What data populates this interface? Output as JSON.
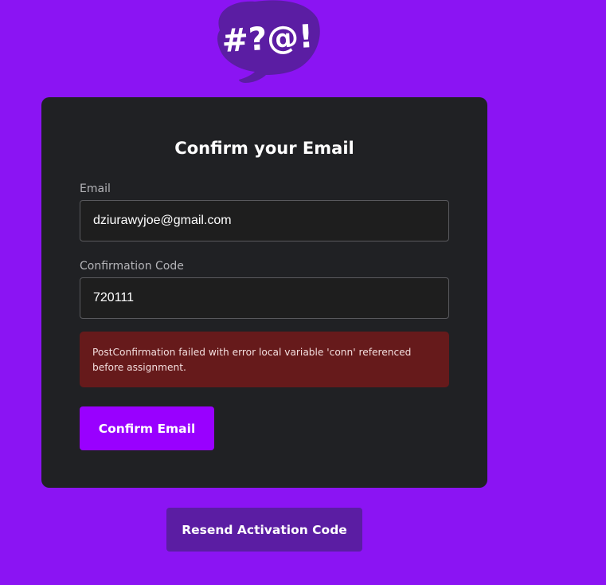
{
  "logo": {
    "text": "#?@!",
    "bubble_color": "#5b1da3"
  },
  "card": {
    "title": "Confirm your Email",
    "email": {
      "label": "Email",
      "value": "dziurawyjoe@gmail.com"
    },
    "code": {
      "label": "Confirmation Code",
      "value": "720111"
    },
    "error_message": "PostConfirmation failed with error local variable 'conn' referenced before assignment.",
    "confirm_button": "Confirm Email"
  },
  "resend_button": "Resend Activation Code",
  "colors": {
    "background": "#8b14f3",
    "card": "#202124",
    "primary": "#9900ff",
    "secondary": "#5b1da3",
    "error": "#661a1b"
  }
}
